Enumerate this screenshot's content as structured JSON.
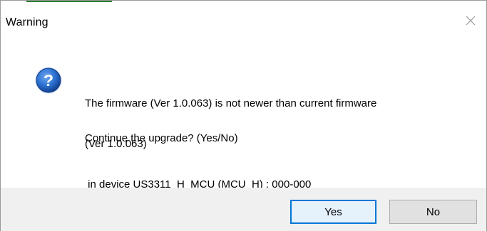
{
  "window": {
    "title": "Warning"
  },
  "message": {
    "lines": [
      "The firmware (Ver 1.0.063) is not newer than current firmware",
      "(Ver 1.0.063)",
      " in device US3311_H_MCU (MCU_H) : 000-000"
    ],
    "prompt": "Continue the upgrade? (Yes/No)"
  },
  "buttons": {
    "yes_label": "Yes",
    "no_label": "No"
  },
  "icons": {
    "dialog_icon": "question-icon",
    "close_icon": "close-icon"
  },
  "colors": {
    "icon_blue": "#1f5fbf",
    "footer_bg": "#f0f0f0",
    "button_bg": "#e1e1e1",
    "default_button_border": "#0078d7"
  }
}
